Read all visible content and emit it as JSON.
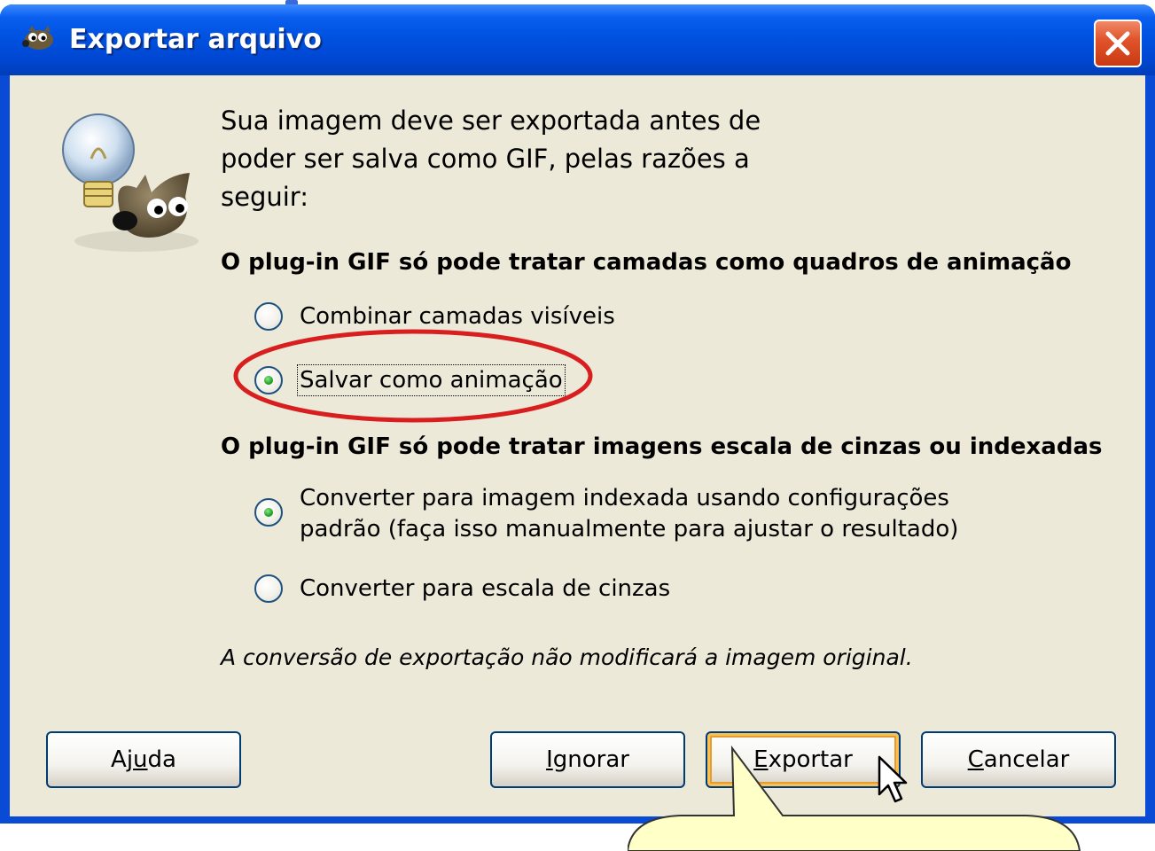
{
  "window": {
    "title": "Exportar arquivo"
  },
  "intro": {
    "line1": "Sua imagem deve ser exportada antes de",
    "line2": "poder ser salva como GIF, pelas razões a",
    "line3": "seguir:"
  },
  "layers_section": {
    "title": "O plug-in GIF só pode tratar camadas como quadros de animação",
    "options": [
      {
        "label": "Combinar camadas visíveis",
        "selected": false
      },
      {
        "label": "Salvar como animação",
        "selected": true
      }
    ]
  },
  "color_section": {
    "title": "O plug-in GIF só pode tratar imagens escala de cinzas ou indexadas",
    "options": [
      {
        "label_line1": "Converter para imagem indexada usando configurações",
        "label_line2": "padrão (faça isso manualmente para ajustar o resultado)",
        "selected": true
      },
      {
        "label": "Converter para escala de cinzas",
        "selected": false
      }
    ]
  },
  "note": "A conversão de exportação não modificará a imagem original.",
  "buttons": {
    "help": {
      "pre": "Aj",
      "ul": "u",
      "post": "da"
    },
    "ignore": {
      "pre": "",
      "ul": "I",
      "post": "gnorar"
    },
    "export": {
      "pre": "",
      "ul": "E",
      "post": "xportar"
    },
    "cancel": {
      "pre": "",
      "ul": "C",
      "post": "ancelar"
    }
  },
  "colors": {
    "titlebar": "#0052e0",
    "client_bg": "#ece9d8",
    "annotation_red": "#d81e1e",
    "radio_selected": "#21a121",
    "tooltip_yellow": "#ffffc8"
  },
  "icons": {
    "title_icon": "gimp-wilber-icon",
    "dialog_icon": "gimp-wilber-lightbulb-icon",
    "close": "close-icon",
    "cursor": "mouse-pointer-icon"
  }
}
